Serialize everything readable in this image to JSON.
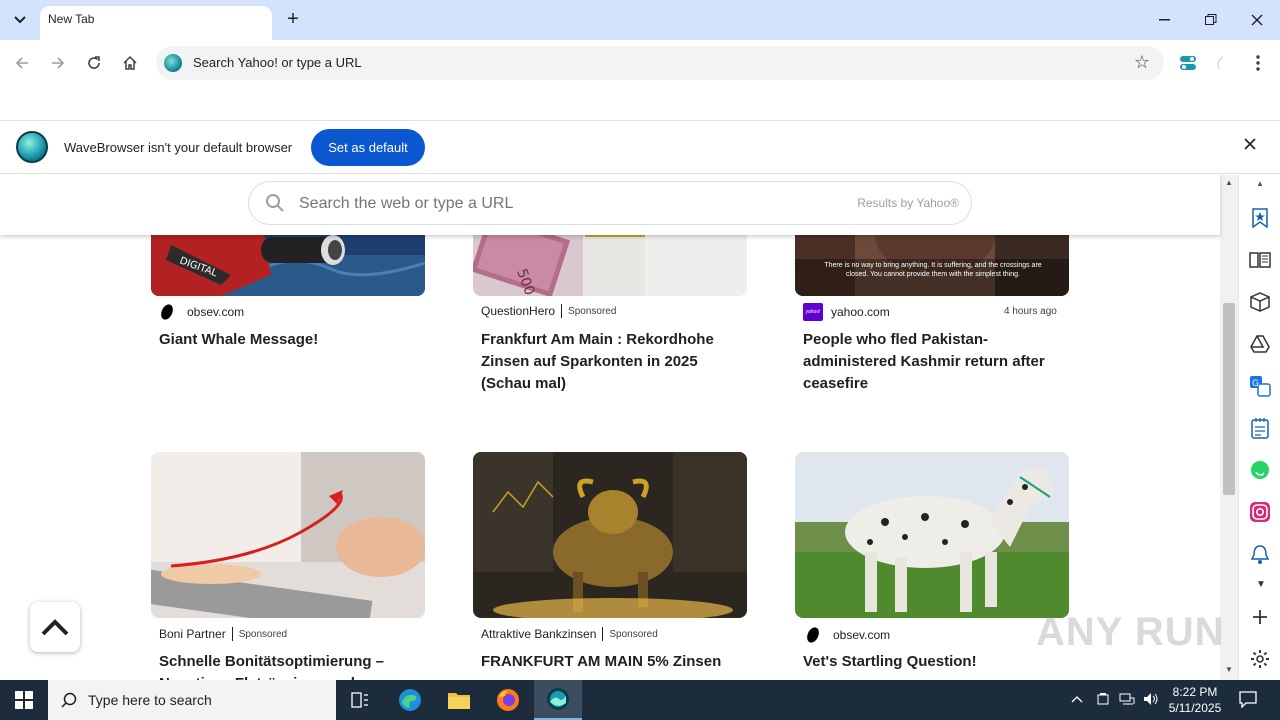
{
  "browser": {
    "tab_title": "New Tab",
    "omnibox_placeholder": "Search Yahoo! or type a URL"
  },
  "infobar": {
    "message": "WaveBrowser isn't your default browser",
    "button_label": "Set as default"
  },
  "page_search": {
    "placeholder": "Search the web or type a URL",
    "credit": "Results by Yahoo®"
  },
  "cards_row1": [
    {
      "source": "obsev.com",
      "sponsored": "",
      "time": "",
      "headline": "Giant Whale Message!"
    },
    {
      "source": "QuestionHero",
      "sponsored": "Sponsored",
      "time": "",
      "headline": "Frankfurt Am Main : Rekordhohe Zinsen auf Sparkonten in 2025 (Schau mal)"
    },
    {
      "source": "yahoo.com",
      "sponsored": "",
      "time": "4 hours ago",
      "headline": "People who fled Pakistan-administered Kashmir return after ceasefire"
    }
  ],
  "cards_row2": [
    {
      "source": "Boni Partner",
      "sponsored": "Sponsored",
      "headline": "Schnelle Bonitätsoptimierung – Neuetiges Flatrönziege und..."
    },
    {
      "source": "Attraktive Bankzinsen",
      "sponsored": "Sponsored",
      "headline": "FRANKFURT AM MAIN 5% Zinsen"
    },
    {
      "source": "obsev.com",
      "sponsored": "",
      "headline": "Vet's Startling Question!"
    }
  ],
  "image_captions": {
    "kashmir_caption": "There is no way to bring anything. It is suffering, and the crossings are closed. You cannot provide them with the simplest thing."
  },
  "watermark": "ANY RUN",
  "taskbar": {
    "search_placeholder": "Type here to search",
    "time": "8:22 PM",
    "date": "5/11/2025"
  },
  "colors": {
    "titlebar": "#d3e3fd",
    "accent_button": "#0b57d0",
    "taskbar": "#1c2c3c"
  }
}
